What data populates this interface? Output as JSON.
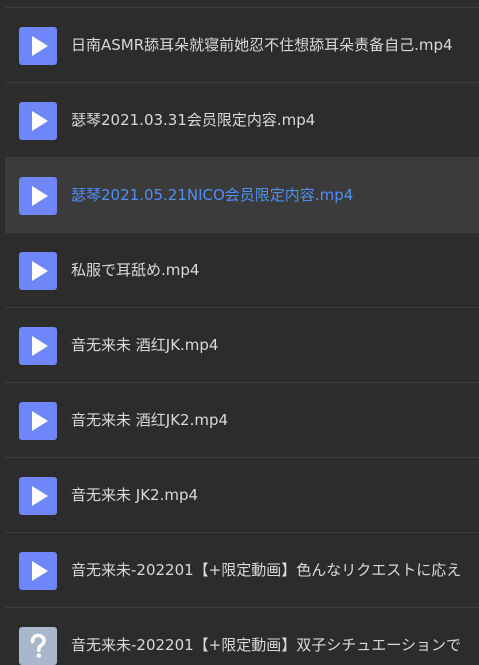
{
  "files": [
    {
      "name": "日南ASMR舔耳朵就寝前她忍不住想舔耳朵责备自己.mp4",
      "icon": "play-icon",
      "selected": false
    },
    {
      "name": "瑟琴2021.03.31会员限定内容.mp4",
      "icon": "play-icon",
      "selected": false
    },
    {
      "name": "瑟琴2021.05.21NICO会员限定内容.mp4",
      "icon": "play-icon",
      "selected": true
    },
    {
      "name": "私服で耳舐め.mp4",
      "icon": "play-icon",
      "selected": false
    },
    {
      "name": "音无来未 酒红JK.mp4",
      "icon": "play-icon",
      "selected": false
    },
    {
      "name": "音无来未 酒红JK2.mp4",
      "icon": "play-icon",
      "selected": false
    },
    {
      "name": "音无来未 JK2.mp4",
      "icon": "play-icon",
      "selected": false
    },
    {
      "name": "音无来未-202201【+限定動画】色んなリクエストに応え",
      "icon": "play-icon",
      "selected": false
    },
    {
      "name": "音无来未-202201【+限定動画】双子シチュエーションで",
      "icon": "unknown-file-icon",
      "selected": false
    }
  ],
  "colors": {
    "background": "#2c2c2c",
    "selected_row": "#3b3b3b",
    "selected_text": "#4f8ff5",
    "video_icon": "#6f86fb",
    "unknown_icon": "#a9b6cc"
  }
}
